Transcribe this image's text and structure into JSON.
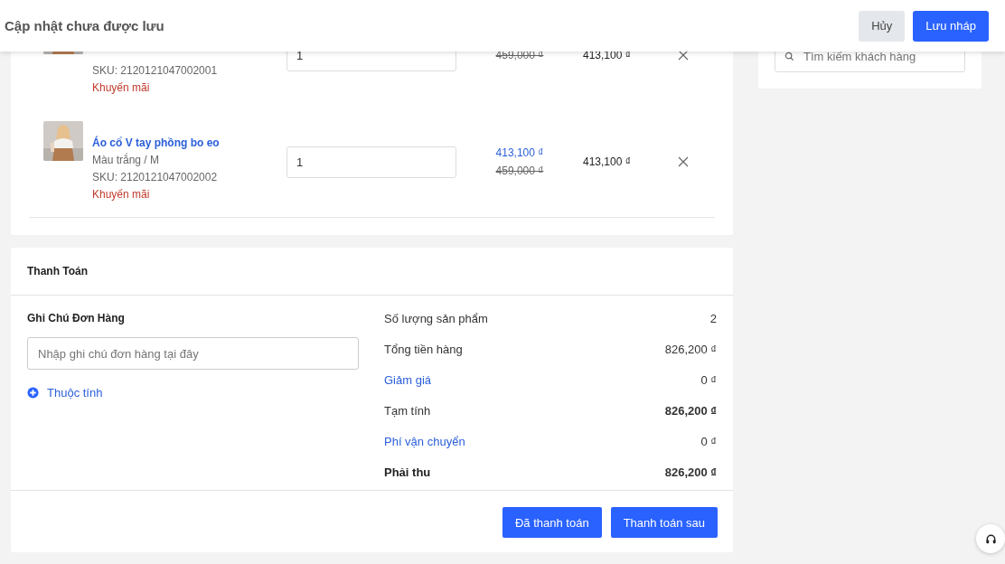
{
  "header": {
    "title": "Cập nhật chưa được lưu",
    "buttons": [
      {
        "label": "Hủy",
        "kind": "secondary"
      },
      {
        "label": "Lưu nháp",
        "kind": "primary"
      }
    ]
  },
  "products": [
    {
      "sku": "SKU: 2120121047002001",
      "promo": "Khuyến mãi",
      "quantity": "1",
      "old_price": "459,000 ₫",
      "total": "413,100 ₫"
    },
    {
      "name": "Áo cổ V tay phồng bo eo",
      "variant": "Màu trắng / M",
      "sku": "SKU: 2120121047002002",
      "promo": "Khuyến mãi",
      "quantity": "1",
      "price": "413,100 ₫",
      "old_price": "459,000 ₫",
      "total": "413,100 ₫"
    }
  ],
  "customer_search": {
    "placeholder": "Tìm kiếm khách hàng"
  },
  "payment": {
    "title": "Thanh Toán",
    "note_label": "Ghi Chú Đơn Hàng",
    "note_placeholder": "Nhập ghi chú đơn hàng tại đây",
    "attribute_link": "Thuộc tính",
    "summary": [
      {
        "label": "Số lượng sản phẩm",
        "value": "2",
        "kind": "plain"
      },
      {
        "label": "Tổng tiền hàng",
        "value": "826,200 ₫",
        "kind": "plain"
      },
      {
        "label": "Giảm giá",
        "value": "0 ₫",
        "kind": "link"
      },
      {
        "label": "Tạm tính",
        "value": "826,200 ₫",
        "kind": "subtotal"
      },
      {
        "label": "Phí vận chuyển",
        "value": "0 ₫",
        "kind": "link"
      },
      {
        "label": "Phải thu",
        "value": "826,200 ₫",
        "kind": "total"
      }
    ],
    "buttons": [
      "Đã thanh toán",
      "Thanh toán sau"
    ]
  }
}
